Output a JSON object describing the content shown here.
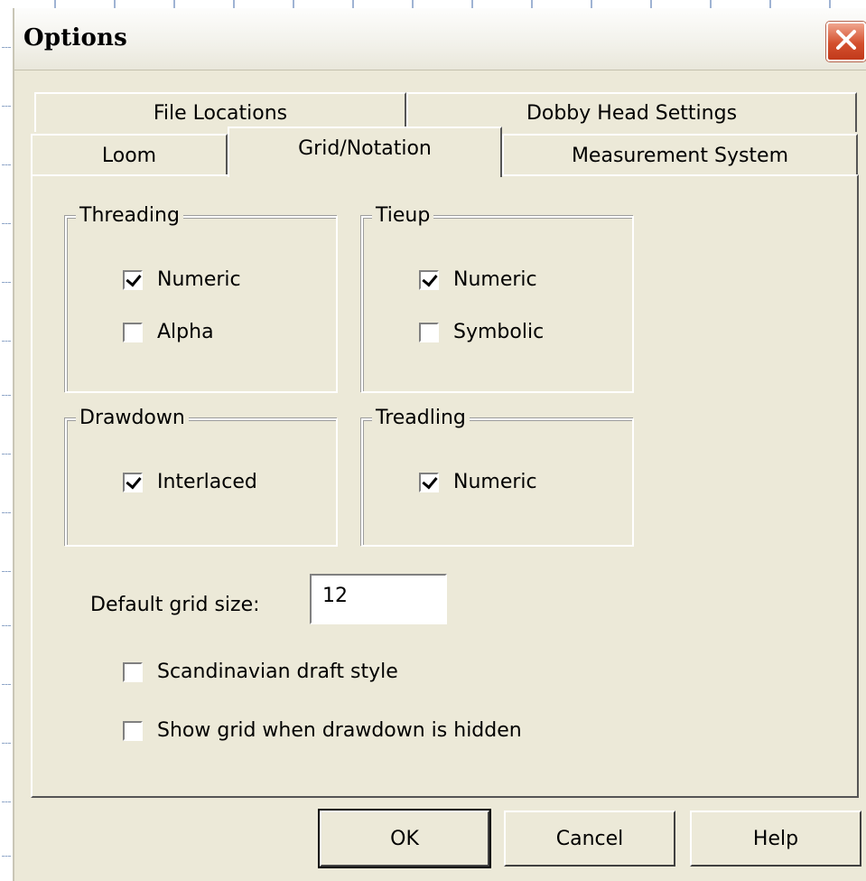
{
  "window": {
    "title": "Options"
  },
  "tabs": {
    "row1": [
      {
        "label": "File Locations"
      },
      {
        "label": "Dobby Head Settings"
      }
    ],
    "row2": [
      {
        "label": "Loom"
      },
      {
        "label": "Grid/Notation",
        "active": true
      },
      {
        "label": "Measurement System"
      }
    ]
  },
  "groups": {
    "threading": {
      "legend": "Threading",
      "options": [
        {
          "label": "Numeric",
          "checked": true
        },
        {
          "label": "Alpha",
          "checked": false
        }
      ]
    },
    "tieup": {
      "legend": "Tieup",
      "options": [
        {
          "label": "Numeric",
          "checked": true
        },
        {
          "label": "Symbolic",
          "checked": false
        }
      ]
    },
    "drawdown": {
      "legend": "Drawdown",
      "options": [
        {
          "label": "Interlaced",
          "checked": true
        }
      ]
    },
    "treadling": {
      "legend": "Treadling",
      "options": [
        {
          "label": "Numeric",
          "checked": true
        }
      ]
    }
  },
  "grid_size": {
    "label": "Default grid size:",
    "value": "12"
  },
  "extra_options": [
    {
      "label": "Scandinavian draft style",
      "checked": false
    },
    {
      "label": "Show grid when drawdown is hidden",
      "checked": false
    }
  ],
  "buttons": {
    "ok": "OK",
    "cancel": "Cancel",
    "help": "Help"
  },
  "icons": {
    "close": "close-icon"
  },
  "colors": {
    "dialog_bg": "#ece9d8",
    "close_red": "#d4502e"
  }
}
